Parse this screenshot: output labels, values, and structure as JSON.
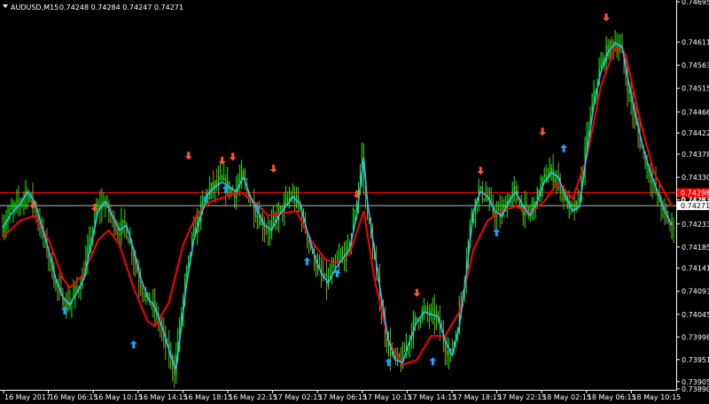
{
  "header": {
    "symbol": "AUDUSD,M15",
    "ohlc": "0.74248 0.74284 0.74247 0.74271"
  },
  "colors": {
    "background": "#000000",
    "foreground": "#ffffff",
    "bull_candle": "#00ff00",
    "bear_candle": "#7fa61a",
    "fast_line": "#33bbff",
    "slow_line": "#ff0000",
    "buy_arrow": "#1aa3ff",
    "sell_arrow": "#ff5522",
    "price_line_current": "#c0c0c0",
    "price_line_level": "#ff0000"
  },
  "chart_data": {
    "type": "candlestick",
    "ylim": [
      0.73888,
      0.74695
    ],
    "y_ticks": [
      "0.74695",
      "0.74611",
      "0.74563",
      "0.74515",
      "0.74466",
      "0.74422",
      "0.74378",
      "0.74330",
      "0.74283",
      "0.74233",
      "0.74185",
      "0.74141",
      "0.74093",
      "0.74045",
      "0.73998",
      "0.73951",
      "0.73905",
      "0.73890"
    ],
    "x_tick_labels": [
      "16 May 2017",
      "16 May 06:15",
      "16 May 10:15",
      "16 May 14:15",
      "16 May 18:15",
      "16 May 22:15",
      "17 May 02:15",
      "17 May 06:15",
      "17 May 10:15",
      "17 May 14:15",
      "17 May 18:15",
      "17 May 22:15",
      "18 May 02:15",
      "18 May 06:15",
      "18 May 10:15"
    ],
    "price_tags": [
      {
        "label": "0.74298",
        "value": 0.74298,
        "bg": "#ff0000",
        "fg": "#ffffff",
        "kind": "level"
      },
      {
        "label": "0.74271",
        "value": 0.74271,
        "bg": "#ffffff",
        "fg": "#000000",
        "kind": "current"
      },
      {
        "label": "0.74283",
        "value": 0.74283,
        "bg": "",
        "fg": "#ffffff",
        "kind": "plain"
      }
    ],
    "price_path": [
      [
        0,
        0.74225
      ],
      [
        5,
        0.74255
      ],
      [
        10,
        0.74275
      ],
      [
        14,
        0.743
      ],
      [
        18,
        0.7428
      ],
      [
        22,
        0.7423
      ],
      [
        26,
        0.7418
      ],
      [
        30,
        0.7412
      ],
      [
        34,
        0.7408
      ],
      [
        38,
        0.74065
      ],
      [
        42,
        0.7409
      ],
      [
        46,
        0.7412
      ],
      [
        50,
        0.7419
      ],
      [
        54,
        0.7426
      ],
      [
        58,
        0.7428
      ],
      [
        62,
        0.7425
      ],
      [
        66,
        0.7422
      ],
      [
        70,
        0.7423
      ],
      [
        74,
        0.7418
      ],
      [
        78,
        0.7412
      ],
      [
        82,
        0.7408
      ],
      [
        86,
        0.7406
      ],
      [
        90,
        0.7402
      ],
      [
        94,
        0.7397
      ],
      [
        98,
        0.7393
      ],
      [
        100,
        0.7399
      ],
      [
        104,
        0.7411
      ],
      [
        108,
        0.742
      ],
      [
        112,
        0.7425
      ],
      [
        116,
        0.74295
      ],
      [
        120,
        0.7431
      ],
      [
        124,
        0.7432
      ],
      [
        128,
        0.7431
      ],
      [
        132,
        0.743
      ],
      [
        136,
        0.7433
      ],
      [
        140,
        0.7429
      ],
      [
        144,
        0.7426
      ],
      [
        148,
        0.7423
      ],
      [
        152,
        0.7422
      ],
      [
        156,
        0.7425
      ],
      [
        160,
        0.7427
      ],
      [
        164,
        0.7429
      ],
      [
        168,
        0.74275
      ],
      [
        172,
        0.7422
      ],
      [
        176,
        0.7417
      ],
      [
        180,
        0.7413
      ],
      [
        184,
        0.7411
      ],
      [
        188,
        0.7414
      ],
      [
        192,
        0.7416
      ],
      [
        196,
        0.7418
      ],
      [
        200,
        0.7425
      ],
      [
        204,
        0.7437
      ],
      [
        206,
        0.7428
      ],
      [
        210,
        0.7418
      ],
      [
        214,
        0.7408
      ],
      [
        218,
        0.7399
      ],
      [
        222,
        0.7395
      ],
      [
        226,
        0.73945
      ],
      [
        230,
        0.7399
      ],
      [
        234,
        0.7403
      ],
      [
        238,
        0.7405
      ],
      [
        242,
        0.74045
      ],
      [
        246,
        0.7404
      ],
      [
        250,
        0.7399
      ],
      [
        254,
        0.7396
      ],
      [
        258,
        0.7402
      ],
      [
        262,
        0.7413
      ],
      [
        266,
        0.7426
      ],
      [
        270,
        0.743
      ],
      [
        274,
        0.7429
      ],
      [
        278,
        0.7426
      ],
      [
        282,
        0.7425
      ],
      [
        286,
        0.7428
      ],
      [
        290,
        0.743
      ],
      [
        294,
        0.7427
      ],
      [
        298,
        0.7425
      ],
      [
        302,
        0.7428
      ],
      [
        306,
        0.7432
      ],
      [
        310,
        0.7434
      ],
      [
        314,
        0.7433
      ],
      [
        318,
        0.7429
      ],
      [
        322,
        0.7426
      ],
      [
        326,
        0.7427
      ],
      [
        330,
        0.7438
      ],
      [
        334,
        0.7448
      ],
      [
        338,
        0.7455
      ],
      [
        342,
        0.7459
      ],
      [
        346,
        0.7461
      ],
      [
        350,
        0.746
      ],
      [
        354,
        0.7452
      ],
      [
        358,
        0.7445
      ],
      [
        362,
        0.7439
      ],
      [
        366,
        0.7434
      ],
      [
        370,
        0.743
      ],
      [
        374,
        0.7426
      ],
      [
        378,
        0.7423
      ]
    ],
    "slow_path": [
      [
        0,
        0.74205
      ],
      [
        10,
        0.7424
      ],
      [
        18,
        0.7425
      ],
      [
        26,
        0.742
      ],
      [
        34,
        0.7412
      ],
      [
        38,
        0.741
      ],
      [
        46,
        0.7413
      ],
      [
        54,
        0.742
      ],
      [
        60,
        0.7422
      ],
      [
        66,
        0.7419
      ],
      [
        74,
        0.741
      ],
      [
        82,
        0.7403
      ],
      [
        86,
        0.7402
      ],
      [
        94,
        0.7407
      ],
      [
        102,
        0.7419
      ],
      [
        110,
        0.74255
      ],
      [
        118,
        0.7428
      ],
      [
        126,
        0.7429
      ],
      [
        134,
        0.743
      ],
      [
        142,
        0.7428
      ],
      [
        150,
        0.7425
      ],
      [
        158,
        0.74255
      ],
      [
        166,
        0.7426
      ],
      [
        174,
        0.742
      ],
      [
        182,
        0.7416
      ],
      [
        188,
        0.7415
      ],
      [
        196,
        0.7417
      ],
      [
        204,
        0.7426
      ],
      [
        210,
        0.7412
      ],
      [
        218,
        0.7399
      ],
      [
        226,
        0.7394
      ],
      [
        234,
        0.7395
      ],
      [
        242,
        0.74
      ],
      [
        250,
        0.74
      ],
      [
        258,
        0.7405
      ],
      [
        266,
        0.7418
      ],
      [
        274,
        0.7424
      ],
      [
        282,
        0.7426
      ],
      [
        290,
        0.7427
      ],
      [
        298,
        0.74255
      ],
      [
        306,
        0.7428
      ],
      [
        314,
        0.7432
      ],
      [
        322,
        0.74285
      ],
      [
        330,
        0.7437
      ],
      [
        338,
        0.7452
      ],
      [
        346,
        0.746
      ],
      [
        352,
        0.74585
      ],
      [
        360,
        0.7445
      ],
      [
        368,
        0.7434
      ],
      [
        378,
        0.7427
      ]
    ],
    "sell_arrows": [
      [
        17,
        0.74268
      ],
      [
        52,
        0.74262
      ],
      [
        105,
        0.7437
      ],
      [
        124,
        0.7436
      ],
      [
        130,
        0.74368
      ],
      [
        153,
        0.74343
      ],
      [
        200,
        0.7429
      ],
      [
        234,
        0.74085
      ],
      [
        270,
        0.74339
      ],
      [
        305,
        0.7442
      ],
      [
        341,
        0.74658
      ]
    ],
    "buy_arrows": [
      [
        35,
        0.74058
      ],
      [
        74,
        0.73987
      ],
      [
        115,
        0.7429
      ],
      [
        126,
        0.7431
      ],
      [
        144,
        0.7427
      ],
      [
        172,
        0.7416
      ],
      [
        189,
        0.74135
      ],
      [
        218,
        0.7395
      ],
      [
        243,
        0.73952
      ],
      [
        279,
        0.7422
      ],
      [
        317,
        0.74395
      ]
    ],
    "n_bars": 380
  }
}
